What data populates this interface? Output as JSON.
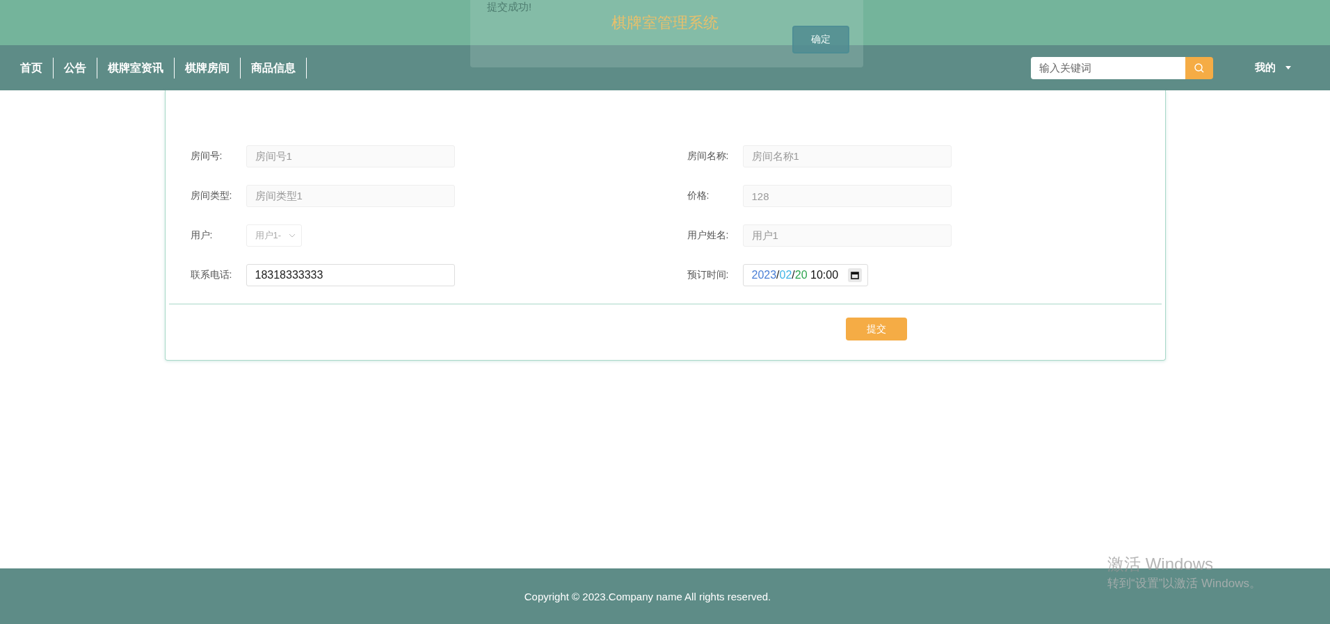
{
  "header": {
    "title": "棋牌室管理系统"
  },
  "nav": {
    "items": [
      {
        "label": "首页",
        "selected": false
      },
      {
        "label": "公告",
        "selected": false
      },
      {
        "label": "棋牌室资讯",
        "selected": false
      },
      {
        "label": "棋牌房间",
        "selected": false
      },
      {
        "label": "商品信息",
        "selected": false
      }
    ],
    "search": {
      "placeholder": "输入关键词"
    },
    "user_menu": {
      "label": "我的"
    }
  },
  "toast": {
    "message": "提交成功!",
    "button": "确定"
  },
  "form": {
    "fields": [
      {
        "label": "房间号:",
        "kind": "text",
        "value": "房间号1",
        "disabled": true
      },
      {
        "label": "房间名称:",
        "kind": "text",
        "value": "房间名称1",
        "disabled": true
      },
      {
        "label": "房间类型:",
        "kind": "text",
        "value": "房间类型1",
        "disabled": true
      },
      {
        "label": "价格:",
        "kind": "text",
        "value": "128",
        "disabled": true
      },
      {
        "label": "用户:",
        "kind": "select",
        "value": "用户1-"
      },
      {
        "label": "用户姓名:",
        "kind": "text",
        "value": "用户1",
        "disabled": true
      },
      {
        "label": "联系电话:",
        "kind": "text",
        "value": "18318333333",
        "disabled": false
      },
      {
        "label": "预订时间:",
        "kind": "date",
        "segments": [
          {
            "text": "2023",
            "color": "#4a7fd6"
          },
          {
            "text": "/",
            "color": "#222222"
          },
          {
            "text": "02",
            "color": "#3fb5e6"
          },
          {
            "text": "/",
            "color": "#222222"
          },
          {
            "text": "20",
            "color": "#2da44e"
          },
          {
            "text": " 10:00",
            "color": "#111111"
          }
        ]
      }
    ],
    "submit": "提交"
  },
  "footer": {
    "copyright": "Copyright © 2023.Company name All rights reserved."
  },
  "os_notice": {
    "title": "激活 Windows",
    "text": "转到“设置”以激活 Windows。"
  }
}
